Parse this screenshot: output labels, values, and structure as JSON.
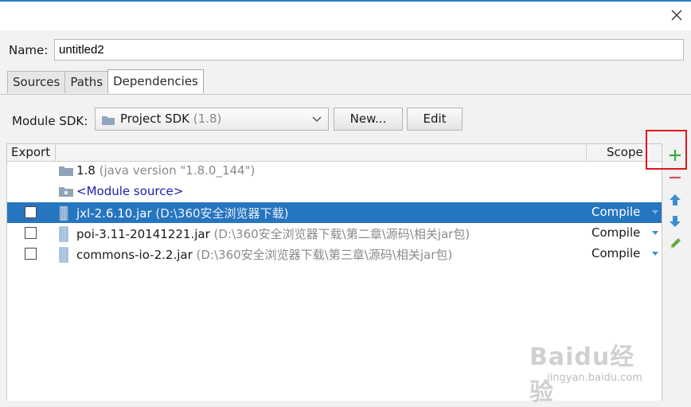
{
  "dialog": {
    "close_icon": "close-icon"
  },
  "name_field": {
    "label": "Name:",
    "value": "untitled2"
  },
  "tabs": [
    {
      "label": "Sources",
      "active": false
    },
    {
      "label": "Paths",
      "active": false
    },
    {
      "label": "Dependencies",
      "active": true
    }
  ],
  "sdk": {
    "label": "Module SDK:",
    "selected": "Project SDK",
    "version": "(1.8)",
    "new_button": "New...",
    "edit_button": "Edit"
  },
  "table": {
    "headers": {
      "export": "Export",
      "scope": "Scope"
    },
    "rows": [
      {
        "name": "1.8",
        "detail": "(java version \"1.8.0_144\")",
        "icon": "jdk-folder-icon",
        "checkbox": false,
        "scope": "",
        "selected": false
      },
      {
        "name": "<Module source>",
        "detail": "",
        "icon": "module-source-folder-icon",
        "checkbox": false,
        "scope": "",
        "selected": false
      },
      {
        "name": "jxl-2.6.10.jar",
        "detail": "(D:\\360安全浏览器下载)",
        "icon": "jar-library-icon",
        "checkbox": true,
        "scope": "Compile",
        "selected": true
      },
      {
        "name": "poi-3.11-20141221.jar",
        "detail": "(D:\\360安全浏览器下载\\第二章\\源码\\相关jar包)",
        "icon": "jar-library-icon",
        "checkbox": true,
        "scope": "Compile",
        "selected": false
      },
      {
        "name": "commons-io-2.2.jar",
        "detail": "(D:\\360安全浏览器下载\\第三章\\源码\\相关jar包)",
        "icon": "jar-library-icon",
        "checkbox": true,
        "scope": "Compile",
        "selected": false
      }
    ]
  },
  "toolbar": {
    "add_icon": "plus-icon",
    "remove_icon": "minus-icon",
    "up_icon": "arrow-up-icon",
    "down_icon": "arrow-down-icon",
    "edit_icon": "pencil-icon"
  },
  "watermark": {
    "logo": "Baidu经验",
    "url": "jingyan.baidu.com"
  },
  "colors": {
    "selection": "#2675bf",
    "highlight": "#e0161c",
    "add": "#3ea83e",
    "remove": "#d9534f",
    "arrows": "#3b8ed6"
  }
}
